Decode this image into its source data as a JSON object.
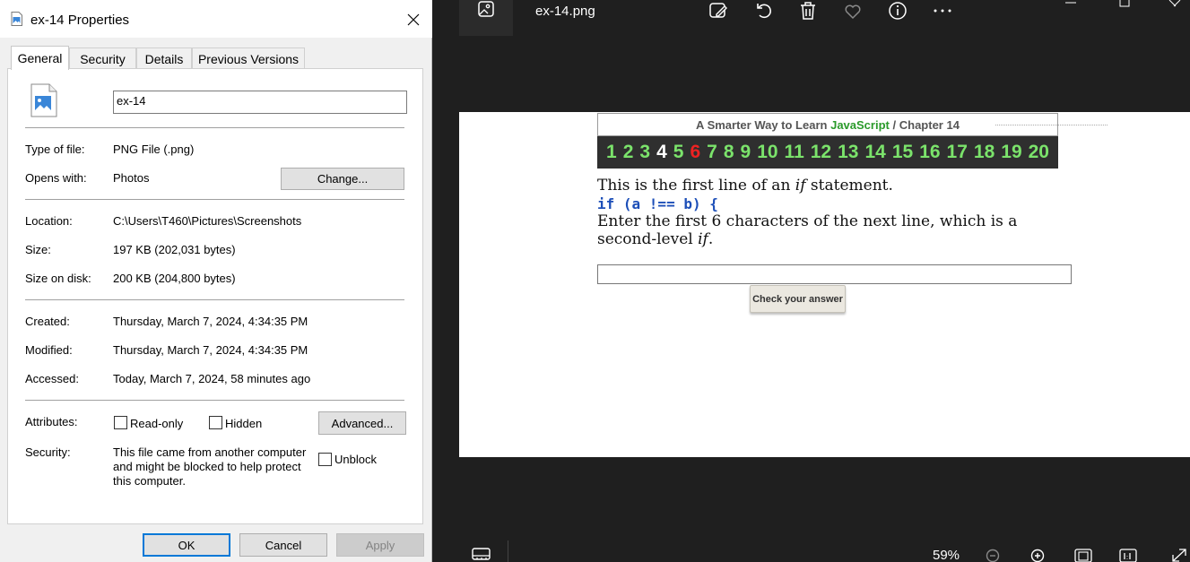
{
  "dialog": {
    "title": "ex-14 Properties",
    "tabs": [
      "General",
      "Security",
      "Details",
      "Previous Versions"
    ],
    "file_name": "ex-14",
    "rows": {
      "type_label": "Type of file:",
      "type_value": "PNG File (.png)",
      "opens_label": "Opens with:",
      "opens_value": "Photos",
      "change_button": "Change...",
      "location_label": "Location:",
      "location_value": "C:\\Users\\T460\\Pictures\\Screenshots",
      "size_label": "Size:",
      "size_value": "197 KB (202,031 bytes)",
      "sizedisk_label": "Size on disk:",
      "sizedisk_value": "200 KB (204,800 bytes)",
      "created_label": "Created:",
      "created_value": "Thursday, March 7, 2024, 4:34:35 PM",
      "modified_label": "Modified:",
      "modified_value": "Thursday, March 7, 2024, 4:34:35 PM",
      "accessed_label": "Accessed:",
      "accessed_value": "Today, March 7, 2024, 58 minutes ago",
      "attributes_label": "Attributes:",
      "readonly_label": "Read-only",
      "hidden_label": "Hidden",
      "advanced_button": "Advanced...",
      "security_label": "Security:",
      "security_text": "This file came from another computer and might be blocked to help protect this computer.",
      "unblock_label": "Unblock"
    },
    "buttons": {
      "ok": "OK",
      "cancel": "Cancel",
      "apply": "Apply"
    }
  },
  "viewer": {
    "filename": "ex-14.png",
    "zoom": "59%",
    "icons": [
      "image-icon",
      "edit-icon",
      "rotate-icon",
      "delete-icon",
      "favorite-icon",
      "info-icon",
      "more-icon",
      "filmstrip-icon",
      "zoom-out-icon",
      "zoom-in-icon",
      "fit-icon",
      "actual-size-icon",
      "fullscreen-icon"
    ],
    "content": {
      "header_prefix": "A Smarter Way to Learn ",
      "header_js": "JavaScript",
      "header_sep": " / ",
      "header_chapter": "Chapter 14",
      "chapters": [
        "1",
        "2",
        "3",
        "4",
        "5",
        "6",
        "7",
        "8",
        "9",
        "10",
        "11",
        "12",
        "13",
        "14",
        "15",
        "16",
        "17",
        "18",
        "19",
        "20"
      ],
      "current_chapter": "4",
      "highlight_chapter": "6",
      "line1_a": "This is the first line of an ",
      "line1_em": "if",
      "line1_b": " statement.",
      "code": "if (a !== b) {",
      "line2": "Enter the first 6 characters of the next line, which is a",
      "line3_a": "second-level ",
      "line3_em": "if",
      "line3_b": ".",
      "check_button": "Check your answer"
    }
  },
  "colors": {
    "dialog_bg": "#f0f0f0",
    "viewer_bg": "#1f1f1f",
    "chapter_green": "#7be36b",
    "chapter_red": "#ee2222",
    "js_green": "#2a9a2a",
    "code_blue": "#1d4fb8"
  }
}
